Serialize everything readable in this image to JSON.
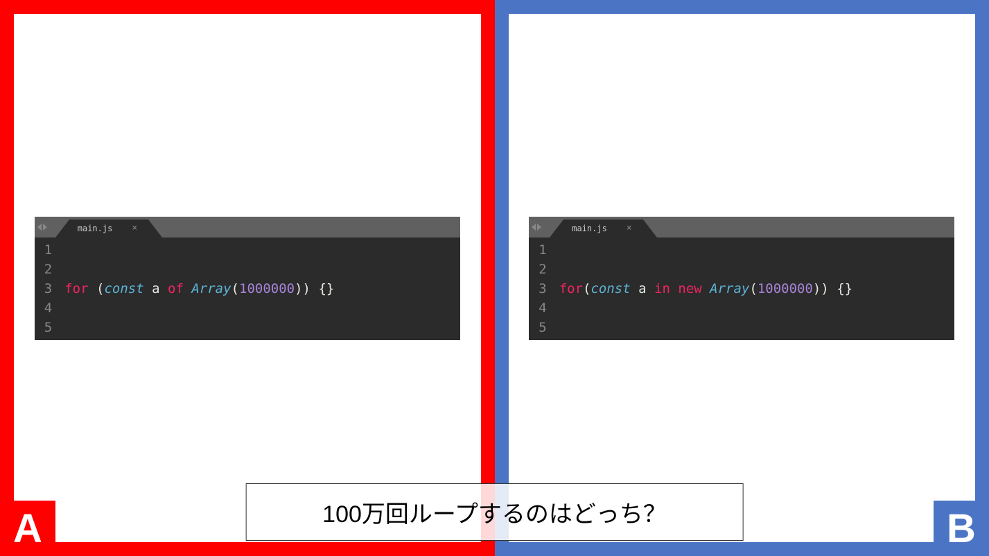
{
  "panelA": {
    "label": "A",
    "tab": "main.js",
    "close": "×",
    "lines": [
      "1",
      "2",
      "3",
      "4",
      "5"
    ],
    "code": {
      "for": "for",
      "sp1": " ",
      "open": "(",
      "const": "const",
      "sp2": " ",
      "ident": "a",
      "sp3": " ",
      "of": "of",
      "sp4": " ",
      "class": "Array",
      "open2": "(",
      "num": "1000000",
      "close2": ")",
      "close": ")",
      "sp5": " ",
      "braces": "{}"
    }
  },
  "panelB": {
    "label": "B",
    "tab": "main.js",
    "close": "×",
    "lines": [
      "1",
      "2",
      "3",
      "4",
      "5"
    ],
    "code": {
      "for": "for",
      "open": "(",
      "const": "const",
      "sp2": " ",
      "ident": "a",
      "sp3": " ",
      "in": "in",
      "sp4": " ",
      "new": "new",
      "sp4b": " ",
      "class": "Array",
      "open2": "(",
      "num": "1000000",
      "close2": ")",
      "close": ")",
      "sp5": " ",
      "braces": "{}"
    }
  },
  "question": "100万回ループするのはどっち？"
}
